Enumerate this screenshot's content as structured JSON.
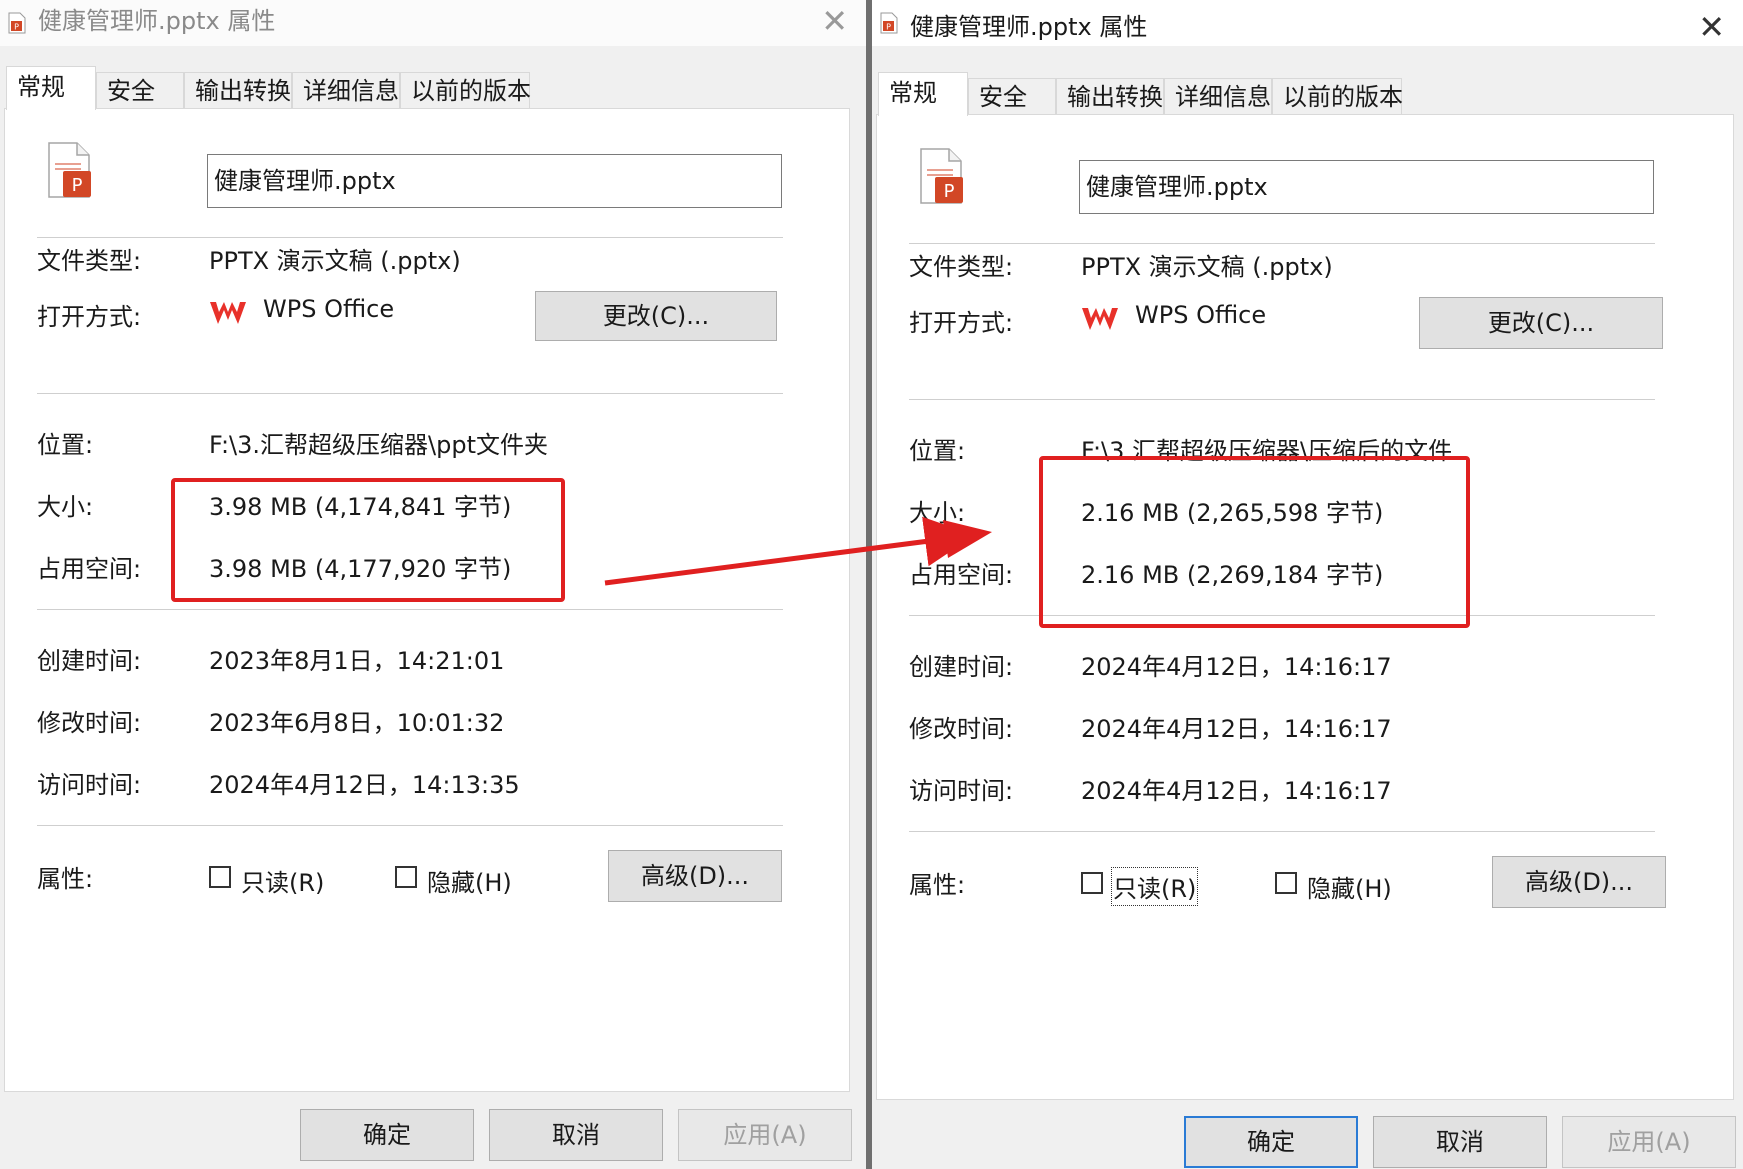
{
  "left": {
    "title": "健康管理师.pptx 属性",
    "tabs": [
      "常规",
      "安全",
      "输出转换",
      "详细信息",
      "以前的版本"
    ],
    "file_name": "健康管理师.pptx",
    "file_type_label": "文件类型:",
    "file_type_value": "PPTX 演示文稿 (.pptx)",
    "open_with_label": "打开方式:",
    "open_with_value": "WPS Office",
    "change_button": "更改(C)...",
    "location_label": "位置:",
    "location_value": "F:\\3.汇帮超级压缩器\\ppt文件夹",
    "size_label": "大小:",
    "size_value": "3.98 MB (4,174,841 字节)",
    "disk_label": "占用空间:",
    "disk_value": "3.98 MB (4,177,920 字节)",
    "created_label": "创建时间:",
    "created_value": "2023年8月1日，14:21:01",
    "modified_label": "修改时间:",
    "modified_value": "2023年6月8日，10:01:32",
    "accessed_label": "访问时间:",
    "accessed_value": "2024年4月12日，14:13:35",
    "attr_label": "属性:",
    "readonly_label": "只读(R)",
    "hidden_label": "隐藏(H)",
    "advanced_button": "高级(D)...",
    "ok_button": "确定",
    "cancel_button": "取消",
    "apply_button": "应用(A)"
  },
  "right": {
    "title": "健康管理师.pptx 属性",
    "tabs": [
      "常规",
      "安全",
      "输出转换",
      "详细信息",
      "以前的版本"
    ],
    "file_name": "健康管理师.pptx",
    "file_type_label": "文件类型:",
    "file_type_value": "PPTX 演示文稿 (.pptx)",
    "open_with_label": "打开方式:",
    "open_with_value": "WPS Office",
    "change_button": "更改(C)...",
    "location_label": "位置:",
    "location_value": "F:\\3.汇帮超级压缩器\\压缩后的文件",
    "size_label": "大小:",
    "size_value": "2.16 MB (2,265,598 字节)",
    "disk_label": "占用空间:",
    "disk_value": "2.16 MB (2,269,184 字节)",
    "created_label": "创建时间:",
    "created_value": "2024年4月12日，14:16:17",
    "modified_label": "修改时间:",
    "modified_value": "2024年4月12日，14:16:17",
    "accessed_label": "访问时间:",
    "accessed_value": "2024年4月12日，14:16:17",
    "attr_label": "属性:",
    "readonly_label": "只读(R)",
    "hidden_label": "隐藏(H)",
    "advanced_button": "高级(D)...",
    "ok_button": "确定",
    "cancel_button": "取消",
    "apply_button": "应用(A)"
  },
  "icons": {
    "file_icon": "powerpoint-file-icon",
    "wps_icon": "wps-office-icon",
    "close_icon": "close-icon"
  },
  "colors": {
    "highlight": "#e02020",
    "pptx_red": "#d24726",
    "wps_red": "#e8312a"
  }
}
